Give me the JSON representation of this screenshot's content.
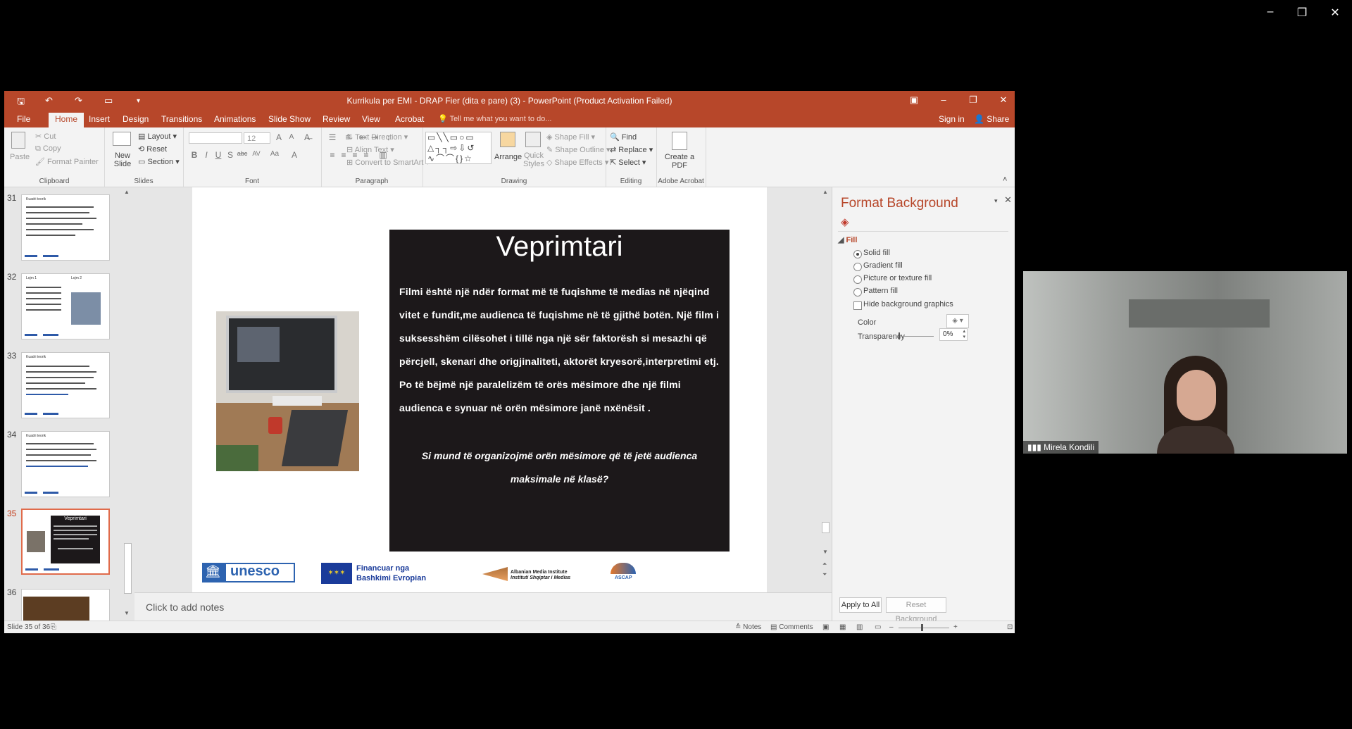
{
  "app": {
    "title": "Kurrikula per EMI - DRAP Fier (dita e pare) (3) - PowerPoint (Product Activation Failed)"
  },
  "tabs": [
    "File",
    "Home",
    "Insert",
    "Design",
    "Transitions",
    "Animations",
    "Slide Show",
    "Review",
    "View",
    "Acrobat"
  ],
  "active_tab": "Home",
  "tell_me_placeholder": "Tell me what you want to do...",
  "sign_in": "Sign in",
  "share": "Share",
  "ribbon": {
    "clipboard": {
      "paste": "Paste",
      "cut": "Cut",
      "copy": "Copy",
      "format_painter": "Format Painter",
      "label": "Clipboard"
    },
    "slides": {
      "new_slide": "New Slide",
      "layout": "Layout",
      "reset": "Reset",
      "section": "Section",
      "label": "Slides"
    },
    "font": {
      "size": "12",
      "label": "Font"
    },
    "paragraph": {
      "text_direction": "Text Direction",
      "align_text": "Align Text",
      "convert_smartart": "Convert to SmartArt",
      "label": "Paragraph"
    },
    "drawing": {
      "arrange": "Arrange",
      "quick_styles": "Quick Styles",
      "shape_fill": "Shape Fill",
      "shape_outline": "Shape Outline",
      "shape_effects": "Shape Effects",
      "label": "Drawing"
    },
    "editing": {
      "find": "Find",
      "replace": "Replace",
      "select": "Select",
      "label": "Editing"
    },
    "acrobat": {
      "create_pdf": "Create a PDF",
      "label": "Adobe Acrobat"
    }
  },
  "thumbnails": [
    {
      "num": "31",
      "title": "Kuadri teorik"
    },
    {
      "num": "32",
      "title": "Lojm 1",
      "title2": "Lojm 2"
    },
    {
      "num": "33",
      "title": "Kuadri teorik"
    },
    {
      "num": "34",
      "title": "Kuadri teorik"
    },
    {
      "num": "35",
      "title": "Veprimtari"
    },
    {
      "num": "36",
      "title": ""
    }
  ],
  "slide": {
    "title": "Veprimtari",
    "body": "Filmi është një ndër format më të fuqishme të medias në njëqind vitet e fundit,me audienca të fuqishme në të gjithë botën. Një film i suksesshëm cilësohet i tillë nga një sër faktorësh si mesazhi që përcjell, skenari dhe origjinaliteti, aktorët kryesorë,interpretimi etj. Po të bëjmë një paralelizëm të orës mësimore dhe një filmi audienca e synuar në orën mësimore janë nxënësit .",
    "question": "Si mund të organizojmë orën mësimore që të jetë audienca maksimale në klasë?",
    "logos": {
      "unesco": "unesco",
      "eu_line1": "Financuar nga",
      "eu_line2": "Bashkimi Evropian",
      "ami_line1": "Albanian Media Institute",
      "ami_line2": "Instituti Shqiptar i Medias",
      "ascap": "ASCAP"
    }
  },
  "notes_placeholder": "Click to add notes",
  "format_background": {
    "title": "Format Background",
    "section": "Fill",
    "options": [
      "Solid fill",
      "Gradient fill",
      "Picture or texture fill",
      "Pattern fill"
    ],
    "selected": "Solid fill",
    "hide_graphics": "Hide background graphics",
    "color_label": "Color",
    "transparency_label": "Transparency",
    "transparency_value": "0%",
    "apply_all": "Apply to All",
    "reset": "Reset Background"
  },
  "status": {
    "slide_info": "Slide 35 of 36",
    "notes": "Notes",
    "comments": "Comments"
  },
  "webcam": {
    "name": "Mirela Kondili"
  },
  "colors": {
    "accent": "#b7472a",
    "slide_dark": "#1c181a"
  }
}
